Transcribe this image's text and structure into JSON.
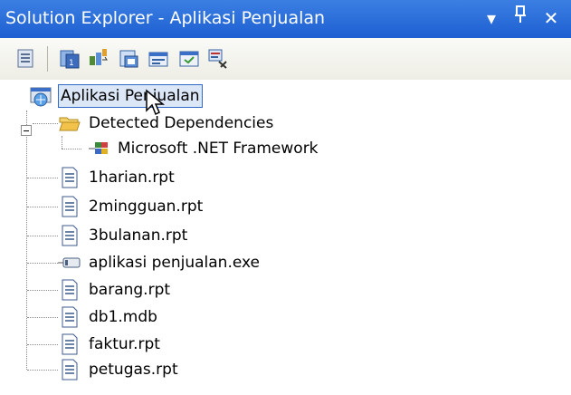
{
  "window": {
    "title": "Solution Explorer - Aplikasi Penjualan",
    "buttons": {
      "dropdown_glyph": "▾",
      "pin_glyph": "ꟼ",
      "close_glyph": "✕"
    }
  },
  "toolbar": {
    "buttons": [
      {
        "name": "properties-icon"
      },
      {
        "name": "show-all-files-icon"
      },
      {
        "name": "refresh-icon"
      },
      {
        "name": "view-code-icon"
      },
      {
        "name": "view-designer-icon"
      },
      {
        "name": "view-class-diagram-icon"
      },
      {
        "name": "copy-web-icon"
      }
    ]
  },
  "tree": {
    "root": {
      "label": "Aplikasi Penjualan",
      "icon": "project-icon"
    },
    "dependencies": {
      "label": "Detected Dependencies",
      "icon": "folder-open-icon"
    },
    "framework": {
      "label": "Microsoft .NET Framework",
      "icon": "framework-icon"
    },
    "files": [
      {
        "label": "1harian.rpt",
        "icon": "document-icon"
      },
      {
        "label": "2mingguan.rpt",
        "icon": "document-icon"
      },
      {
        "label": "3bulanan.rpt",
        "icon": "document-icon"
      },
      {
        "label": "aplikasi penjualan.exe",
        "icon": "executable-icon"
      },
      {
        "label": "barang.rpt",
        "icon": "document-icon"
      },
      {
        "label": "db1.mdb",
        "icon": "document-icon"
      },
      {
        "label": "faktur.rpt",
        "icon": "document-icon"
      },
      {
        "label": "petugas.rpt",
        "icon": "document-icon"
      }
    ]
  },
  "colors": {
    "titlebar": "#2a6ee0",
    "selection_border": "#316ac5",
    "folder": "#f2c24b"
  }
}
